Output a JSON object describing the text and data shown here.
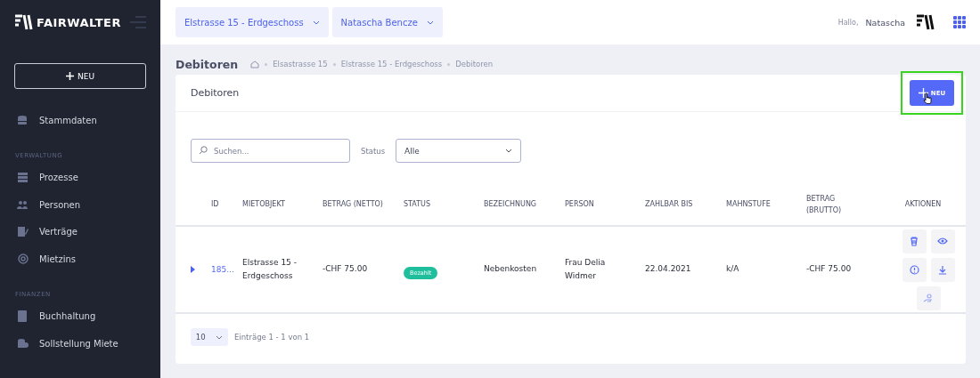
{
  "sidebar": {
    "brand": "FAIRWALTER",
    "new_button": "NEU",
    "sections": [
      {
        "items": [
          {
            "label": "Stammdaten",
            "kind": "database"
          }
        ]
      },
      {
        "title": "VERWALTUNG",
        "items": [
          {
            "label": "Prozesse",
            "kind": "server"
          },
          {
            "label": "Personen",
            "kind": "users"
          },
          {
            "label": "Verträge",
            "kind": "contract"
          },
          {
            "label": "Mietzins",
            "kind": "coins"
          }
        ]
      },
      {
        "title": "FINANZEN",
        "items": [
          {
            "label": "Buchhaltung",
            "kind": "calculator"
          },
          {
            "label": "Sollstellung Miete",
            "kind": "stack"
          }
        ]
      }
    ]
  },
  "topbar": {
    "selectors": [
      "Elstrasse 15 - Erdgeschoss",
      "Natascha Bencze"
    ],
    "greeting": "Hallo,",
    "user": "Natascha"
  },
  "page": {
    "title": "Debitoren",
    "breadcrumb": [
      "Elsastrasse 15",
      "Elstrasse 15 - Erdgeschoss",
      "Debitoren"
    ]
  },
  "card": {
    "title": "Debitoren",
    "new_button": "NEU",
    "highlighted": true,
    "search": {
      "placeholder": "Suchen..."
    },
    "status_filter": {
      "label": "Status",
      "value": "Alle"
    },
    "table": {
      "columns": [
        "ID",
        "MIETOBJEKT",
        "BETRAG (NETTO)",
        "STATUS",
        "BEZEICHNUNG",
        "PERSON",
        "ZAHLBAR BIS",
        "MAHNSTUFE",
        "BETRAG (BRUTTO)",
        "AKTIONEN"
      ],
      "rows": [
        {
          "expanded": false,
          "id": "185...",
          "mietobjekt": "Elstrasse 15 - Erdgeschoss",
          "betrag_netto": "-CHF 75.00",
          "status": "Bezahlt",
          "bezeichnung": "Nebenkosten",
          "person": "Frau Delia Widmer",
          "zahlbar_bis": "22.04.2021",
          "mahnstufe": "k/A",
          "betrag_brutto": "-CHF 75.00",
          "actions": [
            {
              "kind": "delete"
            },
            {
              "kind": "view"
            },
            {
              "kind": "info"
            },
            {
              "kind": "download"
            },
            {
              "kind": "payment"
            }
          ]
        }
      ]
    },
    "pagination": {
      "page_size": "10",
      "summary": "Einträge 1 - 1 von 1"
    }
  }
}
